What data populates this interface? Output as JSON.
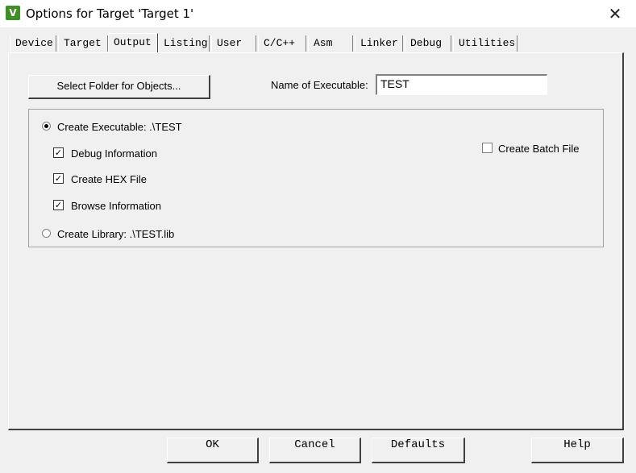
{
  "window": {
    "title": "Options for Target 'Target 1'",
    "close_symbol": "✕",
    "icon": "keil-uvision-icon",
    "icon_glyph": "V"
  },
  "tabs": [
    {
      "label": "Device"
    },
    {
      "label": "Target"
    },
    {
      "label": "Output",
      "active": true
    },
    {
      "label": "Listing"
    },
    {
      "label": "User"
    },
    {
      "label": "C/C++"
    },
    {
      "label": "Asm"
    },
    {
      "label": "Linker"
    },
    {
      "label": "Debug"
    },
    {
      "label": "Utilities"
    }
  ],
  "output": {
    "select_folder_label": "Select Folder for Objects...",
    "exe_name_label": "Name of Executable:",
    "exe_name_value": "TEST",
    "create_executable_label": "Create Executable:  .\\TEST",
    "create_executable_selected": true,
    "debug_info_label": "Debug Information",
    "debug_info_checked": true,
    "hex_file_label": "Create HEX File",
    "hex_file_checked": true,
    "browse_info_label": "Browse Information",
    "browse_info_checked": true,
    "create_library_label": "Create Library:  .\\TEST.lib",
    "create_library_selected": false,
    "batch_file_label": "Create Batch File",
    "batch_file_checked": false
  },
  "buttons": {
    "ok": "OK",
    "cancel": "Cancel",
    "defaults": "Defaults",
    "help": "Help"
  },
  "symbols": {
    "check": "✓"
  }
}
